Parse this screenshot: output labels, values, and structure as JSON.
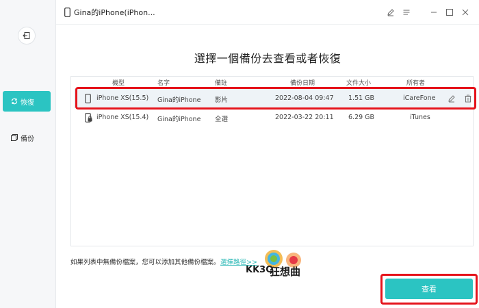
{
  "window": {
    "device_title": "Gina的iPhone(iPhon..."
  },
  "sidebar": {
    "restore_label": "恢復",
    "backup_label": "備份"
  },
  "main": {
    "heading": "選擇一個備份去查看或者恢復",
    "columns": [
      "機型",
      "名字",
      "備註",
      "備份日期",
      "文件大小",
      "所有者"
    ],
    "rows": [
      {
        "model": "iPhone XS(15.5)",
        "name": "Gina的iPhone",
        "note": "影片",
        "date": "2022-08-04 09:47",
        "size": "1.51 GB",
        "owner": "iCareFone",
        "selected": true
      },
      {
        "model": "iPhone XS(15.4)",
        "name": "Gina的iPhone",
        "note": "全選",
        "date": "2022-03-22 20:11",
        "size": "6.29 GB",
        "owner": "iTunes",
        "selected": false
      }
    ],
    "footer_note": "如果列表中無備份檔案，您可以添加其他備份檔案。",
    "footer_link": "選擇路徑>>",
    "view_button": "查看"
  },
  "watermark": {
    "brand": "KK3C",
    "brand_cn": "狂想曲"
  },
  "colors": {
    "accent": "#2bc4c2",
    "highlight": "#e5131b"
  }
}
